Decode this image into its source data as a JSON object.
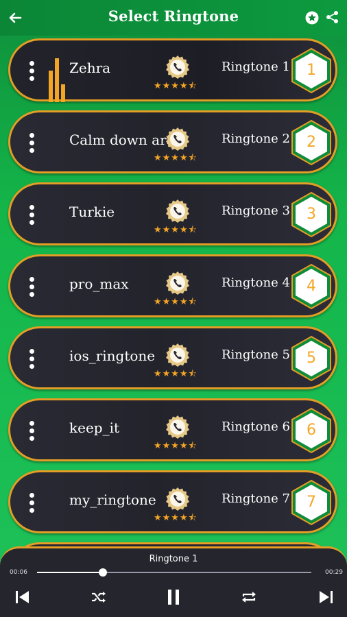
{
  "header": {
    "title": "Select Ringtone",
    "icons": [
      "back-arrow-icon",
      "star-badge-icon",
      "share-icon"
    ]
  },
  "ringtones": [
    {
      "name": "Zehra",
      "label": "Ringtone 1",
      "number": "1",
      "playing": true
    },
    {
      "name": "Calm down arabic",
      "label": "Ringtone 2",
      "number": "2",
      "playing": false
    },
    {
      "name": "Turkie",
      "label": "Ringtone 3",
      "number": "3",
      "playing": false
    },
    {
      "name": "pro_max",
      "label": "Ringtone 4",
      "number": "4",
      "playing": false
    },
    {
      "name": "ios_ringtone",
      "label": "Ringtone 5",
      "number": "5",
      "playing": false
    },
    {
      "name": "keep_it",
      "label": "Ringtone 6",
      "number": "6",
      "playing": false
    },
    {
      "name": "my_ringtone",
      "label": "Ringtone 7",
      "number": "7",
      "playing": false
    }
  ],
  "rating": {
    "stars": 4.5,
    "max": 5
  },
  "player": {
    "now_playing": "Ringtone 1",
    "elapsed": "00:06",
    "duration": "00:29",
    "progress": 0.24
  },
  "colors": {
    "accent": "#f4a623",
    "card_border": "#e59e25",
    "header_green": "#0b8636",
    "card_bg": "#25252e"
  }
}
